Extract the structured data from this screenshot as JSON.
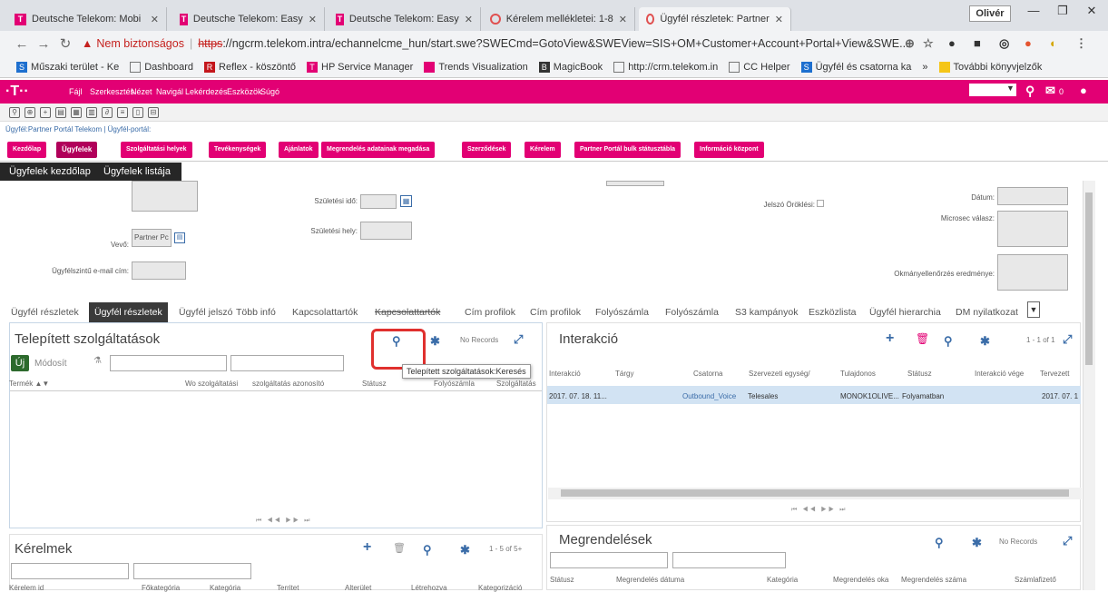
{
  "browser": {
    "tabs": [
      {
        "label": "Deutsche Telekom: Mobi",
        "icon": "telekom-icon"
      },
      {
        "label": "Deutsche Telekom: Easy",
        "icon": "telekom-icon"
      },
      {
        "label": "Deutsche Telekom: Easy",
        "icon": "telekom-icon"
      },
      {
        "label": "Kérelem mellékletei: 1-8",
        "icon": "crm-icon"
      },
      {
        "label": "Ügyfél részletek: Partner",
        "icon": "crm-icon"
      }
    ],
    "user": "Olivér",
    "address": {
      "warning_label": "Nem biztonságos",
      "protocol": "https",
      "url_rest": "://ngcrm.telekom.intra/echannelcme_hun/start.swe?SWECmd=GotoView&SWEView=SIS+OM+Customer+Account+Portal+View&SWE..."
    },
    "bookmarks": [
      "Műszaki terület - Ke",
      "Dashboard",
      "Reflex - köszöntő",
      "HP Service Manager",
      "Trends Visualization",
      "MagicBook",
      "http://crm.telekom.in",
      "CC Helper",
      "Ügyfél és csatorna ka",
      "»",
      "További könyvjelzők"
    ]
  },
  "app": {
    "logo": "·T··",
    "menu": [
      "Fájl",
      "Szerkesztés",
      "Nézet",
      "Navigál",
      "Lekérdezés",
      "Eszközök",
      "Súgó"
    ],
    "notification_count": "0",
    "breadcrumb": "Ügyfél:Partner Portál Telekom | Ügyfél-portál:",
    "screen_tabs": [
      "Kezdőlap",
      "Ügyfelek",
      "Szolgáltatási helyek",
      "Tevékenységek",
      "Ajánlatok",
      "Megrendelés adatainak megadása",
      "Szerződések",
      "Kérelem",
      "Partner Portál bulk státusztábla",
      "Információ központ"
    ],
    "sub_nav": [
      "Ügyfelek kezdőlap",
      "Ügyfelek listája"
    ]
  },
  "form": {
    "birth_date_label": "Születési idő:",
    "birth_place_label": "Születési hely:",
    "buyer_label": "Vevő:",
    "buyer_value": "Partner Pc",
    "email_label": "Ügyfélszintű e-mail cím:",
    "password_inherit_label": "Jelszó Öröklési:",
    "date_label": "Dátum:",
    "microsec_label": "Microsec válasz:",
    "doc_check_label": "Okmányellenőrzés eredménye:"
  },
  "view_tabs": [
    "Ügyfél részletek",
    "Ügyfél részletek",
    "Ügyfél jelszó",
    "Több infó",
    "Kapcsolattartók",
    "Kapcsolattartók",
    "Cím profilok",
    "Cím profilok",
    "Folyószámla",
    "Folyószámla",
    "S3 kampányok",
    "Eszközlista",
    "Ügyfél hierarchia",
    "DM nyilatkozat"
  ],
  "installed_services": {
    "title": "Telepített szolgáltatások",
    "record_count": "No Records",
    "new_button": "Új",
    "modify_button": "Módosít",
    "tooltip": "Telepített szolgáltatások:Keresés",
    "columns": [
      "Termék",
      "Wo szolgáltatási",
      "szolgáltatás azonosító",
      "Státusz",
      "Folyószámla",
      "Szolgáltatás"
    ],
    "pager": "⏮ ◀◀ ▶▶ ⏭"
  },
  "interaction": {
    "title": "Interakció",
    "record_count": "1 - 1 of 1",
    "columns": [
      "Interakció",
      "Tárgy",
      "Csatorna",
      "Szervezeti egység/",
      "Tulajdonos",
      "Státusz",
      "Interakció vége",
      "Tervezett"
    ],
    "rows": [
      {
        "date": "2017. 07. 18. 11...",
        "subject": "",
        "channel": "Outbound_Voice",
        "org": "Telesales",
        "owner": "MONOK1OLIVE...",
        "status": "Folyamatban",
        "end": "",
        "planned": "2017. 07. 1"
      }
    ],
    "pager": "⏮ ◀◀ ▶▶ ⏭"
  },
  "requests": {
    "title": "Kérelmek",
    "record_count": "1 - 5 of 5+",
    "columns": [
      "Kérelem id",
      "Főkategória",
      "Kategória",
      "Territet",
      "Alterület",
      "Létrehozva",
      "Kategorizáció"
    ]
  },
  "orders": {
    "title": "Megrendelések",
    "record_count": "No Records",
    "columns": [
      "Státusz",
      "Megrendelés dátuma",
      "Kategória",
      "Megrendelés oka",
      "Megrendelés száma",
      "Számlafizető"
    ]
  },
  "colors": {
    "brand_magenta": "#e20074",
    "link_blue": "#3a6ca8",
    "highlight_red": "#e0302e"
  }
}
